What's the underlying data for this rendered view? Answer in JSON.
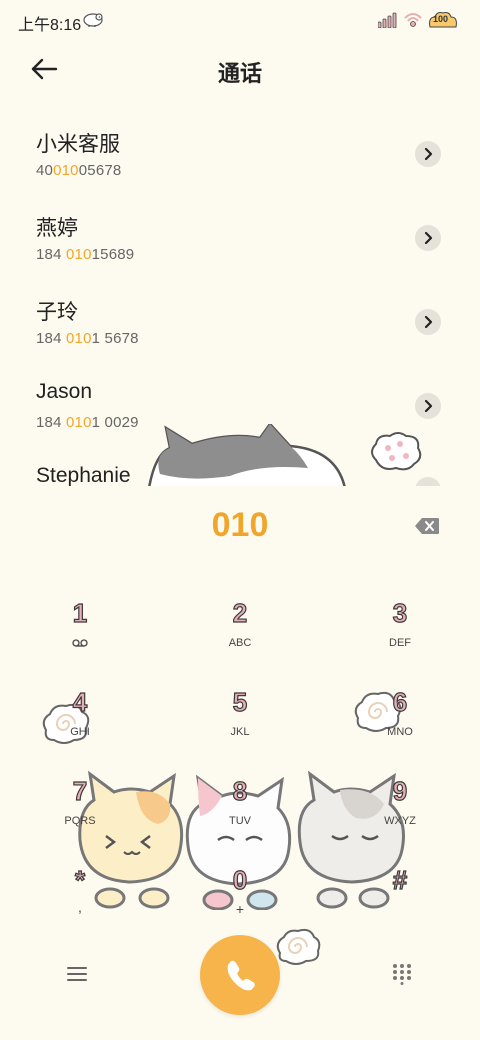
{
  "status": {
    "time": "上午8:16",
    "battery": "100"
  },
  "header": {
    "title": "通话"
  },
  "contacts": [
    {
      "name": "小米客服",
      "num_pre": "40",
      "num_hl": "010",
      "num_post": "05678"
    },
    {
      "name": "燕婷",
      "num_pre": "184 ",
      "num_hl": "010",
      "num_post": "15689"
    },
    {
      "name": "子玲",
      "num_pre": "184 ",
      "num_hl": "010",
      "num_post": "1 5678"
    },
    {
      "name": "Jason",
      "num_pre": "184 ",
      "num_hl": "010",
      "num_post": "1 0029"
    },
    {
      "name": "Stephanie",
      "num_pre": "",
      "num_hl": "",
      "num_post": ""
    }
  ],
  "dialer": {
    "entered": "010",
    "keys": [
      {
        "digit": "1",
        "letters": "voicemail"
      },
      {
        "digit": "2",
        "letters": "ABC"
      },
      {
        "digit": "3",
        "letters": "DEF"
      },
      {
        "digit": "4",
        "letters": "GHI"
      },
      {
        "digit": "5",
        "letters": "JKL"
      },
      {
        "digit": "6",
        "letters": "MNO"
      },
      {
        "digit": "7",
        "letters": "PQRS"
      },
      {
        "digit": "8",
        "letters": "TUV"
      },
      {
        "digit": "9",
        "letters": "WXYZ"
      },
      {
        "digit": "*",
        "letters": ","
      },
      {
        "digit": "0",
        "letters": "+"
      },
      {
        "digit": "#",
        "letters": ""
      }
    ]
  },
  "colors": {
    "accent": "#F0A62A",
    "call_button": "#F7B44A",
    "background": "#FDFBF0"
  },
  "icons": {
    "back": "arrow-left-icon",
    "menu": "menu-icon",
    "call": "phone-icon",
    "keypad": "keypad-icon",
    "backspace": "backspace-icon"
  }
}
